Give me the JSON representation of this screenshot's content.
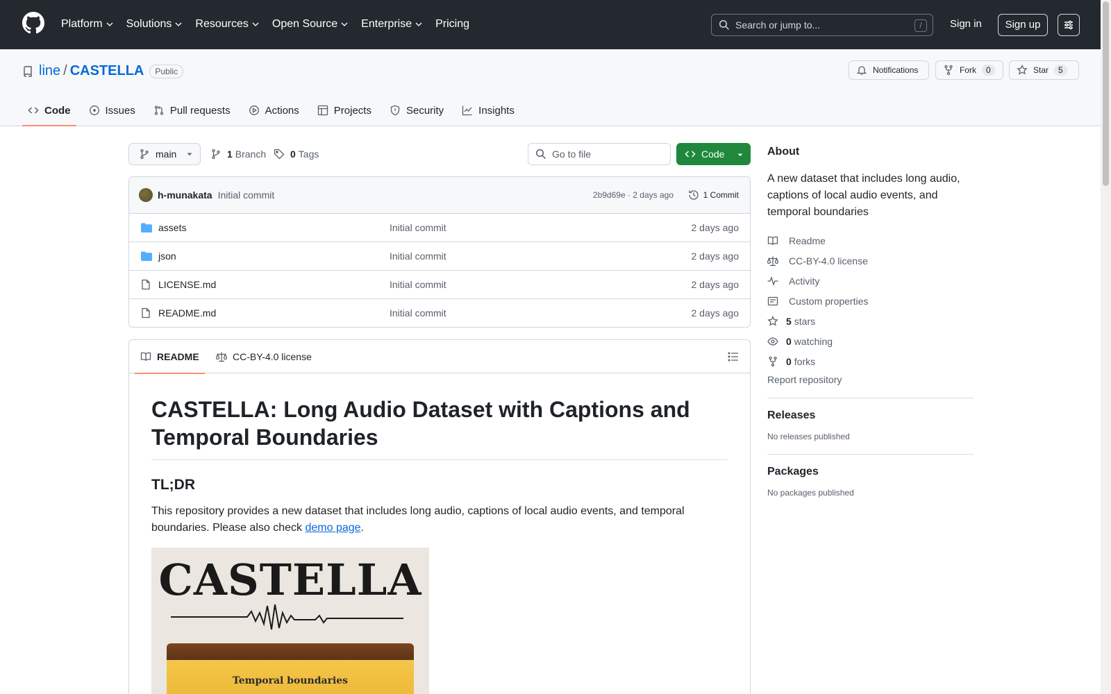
{
  "header": {
    "nav": [
      {
        "label": "Platform",
        "has_dropdown": true
      },
      {
        "label": "Solutions",
        "has_dropdown": true
      },
      {
        "label": "Resources",
        "has_dropdown": true
      },
      {
        "label": "Open Source",
        "has_dropdown": true
      },
      {
        "label": "Enterprise",
        "has_dropdown": true
      },
      {
        "label": "Pricing",
        "has_dropdown": false
      }
    ],
    "search_placeholder": "Search or jump to...",
    "search_shortcut": "/",
    "signin_label": "Sign in",
    "signup_label": "Sign up"
  },
  "repo": {
    "owner": "line",
    "separator": "/",
    "name": "CASTELLA",
    "visibility": "Public",
    "notifications_label": "Notifications",
    "fork_label": "Fork",
    "fork_count": "0",
    "star_label": "Star",
    "star_count": "5",
    "tabs": [
      {
        "label": "Code",
        "icon": "code-icon",
        "active": true
      },
      {
        "label": "Issues",
        "icon": "issue-icon",
        "active": false
      },
      {
        "label": "Pull requests",
        "icon": "pull-request-icon",
        "active": false
      },
      {
        "label": "Actions",
        "icon": "play-icon",
        "active": false
      },
      {
        "label": "Projects",
        "icon": "table-icon",
        "active": false
      },
      {
        "label": "Security",
        "icon": "shield-icon",
        "active": false
      },
      {
        "label": "Insights",
        "icon": "graph-icon",
        "active": false
      }
    ]
  },
  "toolbar": {
    "branch": "main",
    "branch_count": "1",
    "branch_label": "Branch",
    "tag_count": "0",
    "tag_label": "Tags",
    "goto_placeholder": "Go to file",
    "code_button": "Code"
  },
  "commit": {
    "author": "h-munakata",
    "message": "Initial commit",
    "sha_time": "2b9d69e · 2 days ago",
    "commits_label": "1 Commit"
  },
  "files": [
    {
      "name": "assets",
      "type": "folder",
      "message": "Initial commit",
      "date": "2 days ago"
    },
    {
      "name": "json",
      "type": "folder",
      "message": "Initial commit",
      "date": "2 days ago"
    },
    {
      "name": "LICENSE.md",
      "type": "file",
      "message": "Initial commit",
      "date": "2 days ago"
    },
    {
      "name": "README.md",
      "type": "file",
      "message": "Initial commit",
      "date": "2 days ago"
    }
  ],
  "readme": {
    "tab_readme": "README",
    "tab_license": "CC-BY-4.0 license",
    "title": "CASTELLA: Long Audio Dataset with Captions and Temporal Boundaries",
    "h2": "TL;DR",
    "paragraph_before_link": "This repository provides a new dataset that includes long audio, captions of local audio events, and temporal boundaries. Please also check ",
    "link_text": "demo page",
    "paragraph_after_link": ".",
    "image_title": "CASTELLA",
    "image_caption": "Temporal boundaries"
  },
  "about": {
    "heading": "About",
    "description": "A new dataset that includes long audio, captions of local audio events, and temporal boundaries",
    "items": [
      {
        "icon": "book-icon",
        "strong": "",
        "label": "Readme"
      },
      {
        "icon": "law-icon",
        "strong": "",
        "label": "CC-BY-4.0 license"
      },
      {
        "icon": "pulse-icon",
        "strong": "",
        "label": "Activity"
      },
      {
        "icon": "note-icon",
        "strong": "",
        "label": "Custom properties"
      },
      {
        "icon": "star-icon",
        "strong": "5",
        "label": "stars"
      },
      {
        "icon": "eye-icon",
        "strong": "0",
        "label": "watching"
      },
      {
        "icon": "fork-icon",
        "strong": "0",
        "label": "forks"
      }
    ],
    "report": "Report repository"
  },
  "releases": {
    "heading": "Releases",
    "empty": "No releases published"
  },
  "packages": {
    "heading": "Packages",
    "empty": "No packages published"
  },
  "colors": {
    "header_bg": "#24292f",
    "link": "#0969da",
    "primary_button": "#1f883d",
    "active_tab_underline": "#fd8c73"
  }
}
